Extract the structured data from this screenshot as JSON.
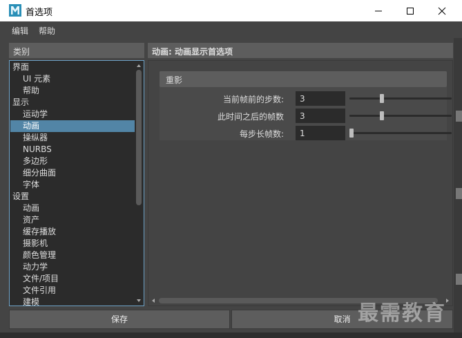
{
  "window": {
    "title": "首选项",
    "app_icon": "maya-m-icon"
  },
  "menu": [
    "编辑",
    "帮助"
  ],
  "categories": {
    "header": "类别",
    "items": [
      {
        "label": "界面",
        "level": 0
      },
      {
        "label": "UI 元素",
        "level": 1
      },
      {
        "label": "帮助",
        "level": 1
      },
      {
        "label": "显示",
        "level": 0
      },
      {
        "label": "运动学",
        "level": 1
      },
      {
        "label": "动画",
        "level": 1,
        "selected": true
      },
      {
        "label": "操纵器",
        "level": 1
      },
      {
        "label": "NURBS",
        "level": 1
      },
      {
        "label": "多边形",
        "level": 1
      },
      {
        "label": "细分曲面",
        "level": 1
      },
      {
        "label": "字体",
        "level": 1
      },
      {
        "label": "设置",
        "level": 0
      },
      {
        "label": "动画",
        "level": 1
      },
      {
        "label": "资产",
        "level": 1
      },
      {
        "label": "缓存播放",
        "level": 1
      },
      {
        "label": "摄影机",
        "level": 1
      },
      {
        "label": "颜色管理",
        "level": 1
      },
      {
        "label": "动力学",
        "level": 1
      },
      {
        "label": "文件/项目",
        "level": 1
      },
      {
        "label": "文件引用",
        "level": 1
      },
      {
        "label": "建模",
        "level": 1
      }
    ]
  },
  "content": {
    "header": "动画: 动画显示首选项",
    "section_title": "重影",
    "fields": [
      {
        "label": "当前帧前的步数:",
        "value": "3",
        "slider_fraction": 0.31
      },
      {
        "label": "此时间之后的帧数",
        "value": "3",
        "slider_fraction": 0.31
      },
      {
        "label": "每步长帧数:",
        "value": "1",
        "slider_fraction": 0.0
      }
    ]
  },
  "buttons": {
    "save": "保存",
    "cancel": "取消"
  },
  "watermark": "最需教育",
  "colors": {
    "selection": "#5285a6",
    "list_border": "#6ea3c9",
    "panel_bg": "#444444",
    "header_bg": "#5d5d5d"
  }
}
